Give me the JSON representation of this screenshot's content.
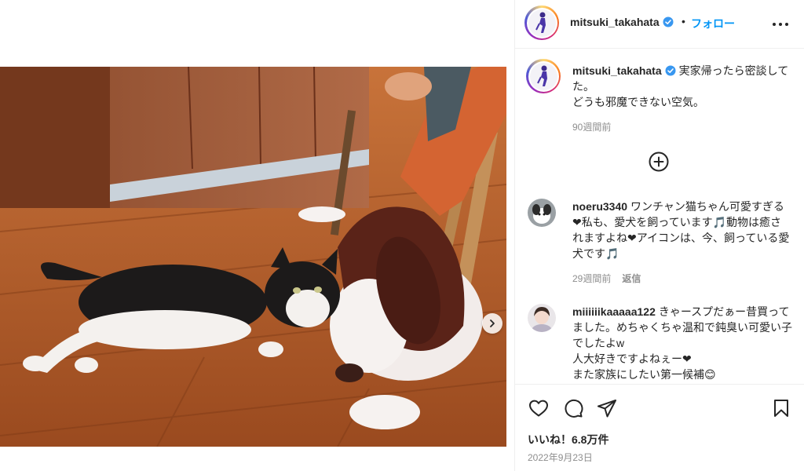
{
  "post": {
    "username": "mitsuki_takahata",
    "follow_label": "フォロー",
    "separator": "•",
    "caption_line1": "実家帰ったら密談してた。",
    "caption_line2": "どうも邪魔できない空気。",
    "caption_time": "90週間前"
  },
  "comments": [
    {
      "username": "noeru3340",
      "text": "ワンチャン猫ちゃん可愛すぎる❤私も、愛犬を飼っています🎵動物は癒されますよね❤アイコンは、今、飼っている愛犬です🎵",
      "time": "29週間前",
      "reply_label": "返信"
    },
    {
      "username": "miiiiiikaaaaa122",
      "text_line1": "きゃースプだぁー昔買ってました。めちゃくちゃ温和で鈍臭い可愛い子でしたよw",
      "text_line2": "人大好きですよねぇー❤",
      "text_line3": "また家族にしたい第一候補😊"
    }
  ],
  "footer": {
    "likes": "いいね！6.8万件",
    "date": "2022年9月23日"
  },
  "icons": {
    "verified": "verified-badge-icon",
    "more": "more-options-icon",
    "load_more": "plus-circle-icon",
    "like": "heart-icon",
    "comment": "comment-icon",
    "share": "share-icon",
    "save": "bookmark-icon",
    "next": "chevron-right-icon"
  },
  "colors": {
    "accent": "#0095f6",
    "text": "#262626",
    "muted": "#8e8e8e",
    "border": "#efefef"
  }
}
